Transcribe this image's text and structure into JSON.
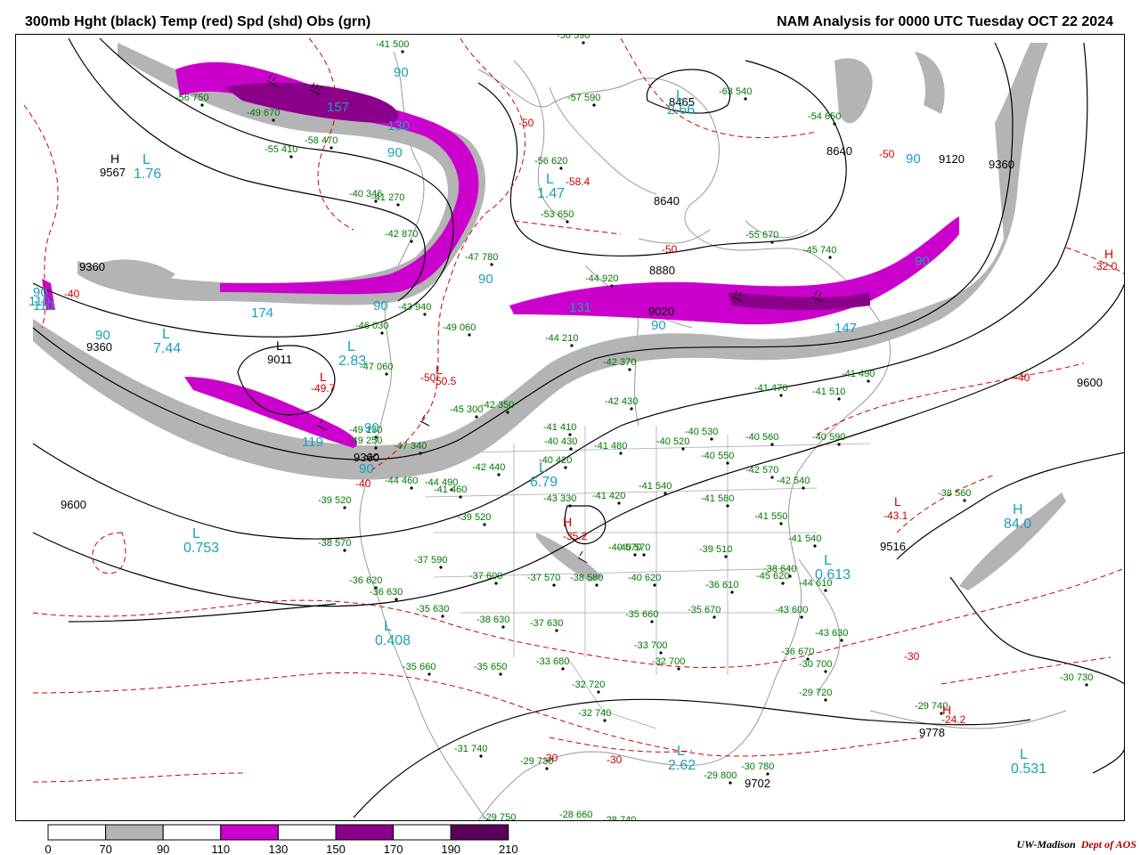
{
  "header": {
    "title_left": "300mb Hght (black) Temp (red) Spd (shd) Obs (grn)",
    "title_right": "NAM Analysis for 0000 UTC Tuesday  OCT 22 2024"
  },
  "colors": {
    "height_contour": "#000000",
    "temp_contour": "#cc0000",
    "obs": "#007700",
    "pressure_center": "#1aa0b8",
    "map_lines": "#999999",
    "speed_70_90": "#b4b4b4",
    "speed_110_130": "#cc00cc",
    "speed_150_170": "#8b008b",
    "speed_190_210": "#5a005a"
  },
  "height_labels": [
    "8465",
    "8640",
    "8640",
    "8880",
    "9020",
    "9120",
    "9360",
    "9360",
    "9360",
    "9360",
    "9567",
    "9600",
    "9600",
    "9011",
    "9516",
    "9778",
    "9702"
  ],
  "temp_labels": [
    "-50",
    "-50",
    "-50",
    "-50",
    "-50.5",
    "-49.7",
    "-58.4",
    "-43.1",
    "-32.0",
    "-40",
    "-40",
    "-40",
    "-30",
    "-30",
    "-30",
    "-35.2",
    "-24.2"
  ],
  "speed_labels": [
    "90",
    "90",
    "90",
    "90",
    "90",
    "90",
    "90",
    "90",
    "90",
    "90",
    "90",
    "110",
    "130",
    "131",
    "147",
    "157",
    "174",
    "119",
    "119"
  ],
  "centers": [
    {
      "type": "L",
      "value": "1.76"
    },
    {
      "type": "L",
      "value": "7.44"
    },
    {
      "type": "L",
      "value": "2.83"
    },
    {
      "type": "L",
      "value": "1.47"
    },
    {
      "type": "L",
      "value": "0.753"
    },
    {
      "type": "L",
      "value": "0.408"
    },
    {
      "type": "L",
      "value": "2.62"
    },
    {
      "type": "L",
      "value": "0.613"
    },
    {
      "type": "L",
      "value": "0.531"
    },
    {
      "type": "L",
      "value": "6.79"
    },
    {
      "type": "H",
      "value": "84.0"
    },
    {
      "type": "L",
      "value": "2.66"
    }
  ],
  "obs": [
    {
      "t": "-41",
      "h": "500"
    },
    {
      "t": "-56",
      "h": "590"
    },
    {
      "t": "-57",
      "h": "590"
    },
    {
      "t": "-63",
      "h": "540"
    },
    {
      "t": "-54",
      "h": "650"
    },
    {
      "t": "-56",
      "h": "620"
    },
    {
      "t": "-53",
      "h": "650"
    },
    {
      "t": "-55",
      "h": "670"
    },
    {
      "t": "-45",
      "h": "740"
    },
    {
      "t": "-47",
      "h": "780"
    },
    {
      "t": "-49",
      "h": "060"
    },
    {
      "t": "-44",
      "h": "210"
    },
    {
      "t": "-42",
      "h": "370"
    },
    {
      "t": "-41",
      "h": "470"
    },
    {
      "t": "-41",
      "h": "510"
    },
    {
      "t": "-41",
      "h": "490"
    },
    {
      "t": "-42",
      "h": "430"
    },
    {
      "t": "-41",
      "h": "410"
    },
    {
      "t": "-40",
      "h": "430"
    },
    {
      "t": "-41",
      "h": "480"
    },
    {
      "t": "-40",
      "h": "520"
    },
    {
      "t": "-40",
      "h": "530"
    },
    {
      "t": "-40",
      "h": "560"
    },
    {
      "t": "-40",
      "h": "590"
    },
    {
      "t": "-40",
      "h": "550"
    },
    {
      "t": "-42",
      "h": "570"
    },
    {
      "t": "-42",
      "h": "540"
    },
    {
      "t": "-41",
      "h": "540"
    },
    {
      "t": "-41",
      "h": "550"
    },
    {
      "t": "-41",
      "h": "580"
    },
    {
      "t": "-40",
      "h": "570"
    },
    {
      "t": "-41",
      "h": "540"
    },
    {
      "t": "-40",
      "h": "420"
    },
    {
      "t": "-42",
      "h": "440"
    },
    {
      "t": "-42",
      "h": "350"
    },
    {
      "t": "-45",
      "h": "300"
    },
    {
      "t": "-43",
      "h": "330"
    },
    {
      "t": "-41",
      "h": "420"
    },
    {
      "t": "-39",
      "h": "520"
    },
    {
      "t": "-39",
      "h": "510"
    },
    {
      "t": "-40",
      "h": "570"
    },
    {
      "t": "-38",
      "h": "570"
    },
    {
      "t": "-37",
      "h": "590"
    },
    {
      "t": "-37",
      "h": "600"
    },
    {
      "t": "-37",
      "h": "570"
    },
    {
      "t": "-38",
      "h": "580"
    },
    {
      "t": "-40",
      "h": "620"
    },
    {
      "t": "-36",
      "h": "620"
    },
    {
      "t": "-36",
      "h": "630"
    },
    {
      "t": "-35",
      "h": "630"
    },
    {
      "t": "-38",
      "h": "630"
    },
    {
      "t": "-37",
      "h": "630"
    },
    {
      "t": "-35",
      "h": "660"
    },
    {
      "t": "-35",
      "h": "670"
    },
    {
      "t": "-36",
      "h": "610"
    },
    {
      "t": "-38",
      "h": "640"
    },
    {
      "t": "-33",
      "h": "700"
    },
    {
      "t": "-32",
      "h": "700"
    },
    {
      "t": "-33",
      "h": "680"
    },
    {
      "t": "-35",
      "h": "650"
    },
    {
      "t": "-35",
      "h": "660"
    },
    {
      "t": "-32",
      "h": "720"
    },
    {
      "t": "-32",
      "h": "740"
    },
    {
      "t": "-31",
      "h": "740"
    },
    {
      "t": "-29",
      "h": "730"
    },
    {
      "t": "-29",
      "h": "800"
    },
    {
      "t": "-30",
      "h": "780"
    },
    {
      "t": "-28",
      "h": "660"
    },
    {
      "t": "-28",
      "h": "740"
    },
    {
      "t": "-29",
      "h": "750"
    },
    {
      "t": "-29",
      "h": "720"
    },
    {
      "t": "-30",
      "h": "700"
    },
    {
      "t": "-29",
      "h": "740"
    },
    {
      "t": "-30",
      "h": "730"
    },
    {
      "t": "-38",
      "h": "560"
    },
    {
      "t": "-43",
      "h": "600"
    },
    {
      "t": "-43",
      "h": "630"
    },
    {
      "t": "-36",
      "h": "670"
    },
    {
      "t": "-49",
      "h": "130"
    },
    {
      "t": "-49",
      "h": "250"
    },
    {
      "t": "-47",
      "h": "340"
    },
    {
      "t": "-44",
      "h": "460"
    },
    {
      "t": "-44",
      "h": "490"
    },
    {
      "t": "-41",
      "h": "460"
    },
    {
      "t": "-39",
      "h": "520"
    },
    {
      "t": "-44",
      "h": "610"
    },
    {
      "t": "-45",
      "h": "620"
    },
    {
      "t": "-46",
      "h": "030"
    },
    {
      "t": "-47",
      "h": "060"
    },
    {
      "t": "-42",
      "h": "870"
    },
    {
      "t": "-40",
      "h": "346"
    },
    {
      "t": "-41",
      "h": "270"
    },
    {
      "t": "-55",
      "h": "410"
    },
    {
      "t": "-58",
      "h": "470"
    },
    {
      "t": "-49",
      "h": "670"
    },
    {
      "t": "-56",
      "h": "750"
    },
    {
      "t": "-44",
      "h": "920"
    },
    {
      "t": "-43",
      "h": "940"
    },
    {
      "t": "-42",
      "h": "050"
    }
  ],
  "legend": {
    "ticks": [
      "0",
      "70",
      "90",
      "110",
      "130",
      "150",
      "170",
      "190",
      "210"
    ]
  },
  "credit": {
    "brand": "UW-Madison",
    "dept": "Dept of AOS"
  }
}
